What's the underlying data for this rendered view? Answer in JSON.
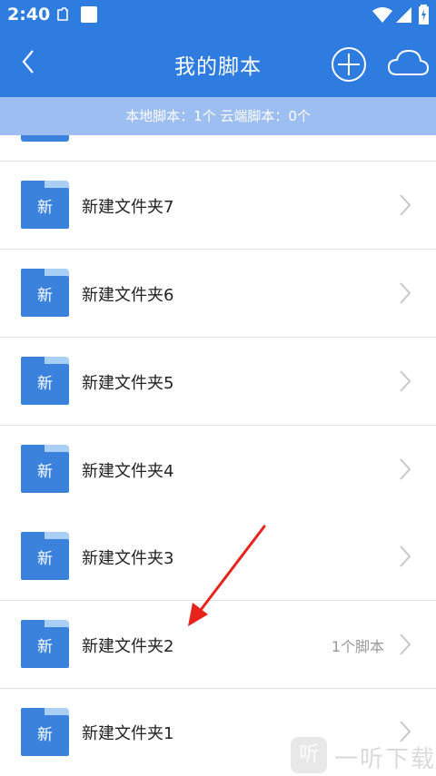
{
  "status_bar": {
    "time": "2:40"
  },
  "header": {
    "title": "我的脚本"
  },
  "summary": {
    "text": "本地脚本：1个 云端脚本：0个"
  },
  "folders": [
    {
      "icon_text": "新",
      "name": "新建文件夹7",
      "count": ""
    },
    {
      "icon_text": "新",
      "name": "新建文件夹6",
      "count": ""
    },
    {
      "icon_text": "新",
      "name": "新建文件夹5",
      "count": ""
    },
    {
      "icon_text": "新",
      "name": "新建文件夹4",
      "count": ""
    },
    {
      "icon_text": "新",
      "name": "新建文件夹3",
      "count": ""
    },
    {
      "icon_text": "新",
      "name": "新建文件夹2",
      "count": "1个脚本"
    },
    {
      "icon_text": "新",
      "name": "新建文件夹1",
      "count": ""
    }
  ],
  "watermark": {
    "badge": "听",
    "text": "一听下载"
  },
  "colors": {
    "primary": "#2f7ce0",
    "summary_bar": "#9cbef0",
    "folder": "#3b82dc",
    "folder_tab": "#a9cff5",
    "annotation_arrow": "#e8231b"
  }
}
